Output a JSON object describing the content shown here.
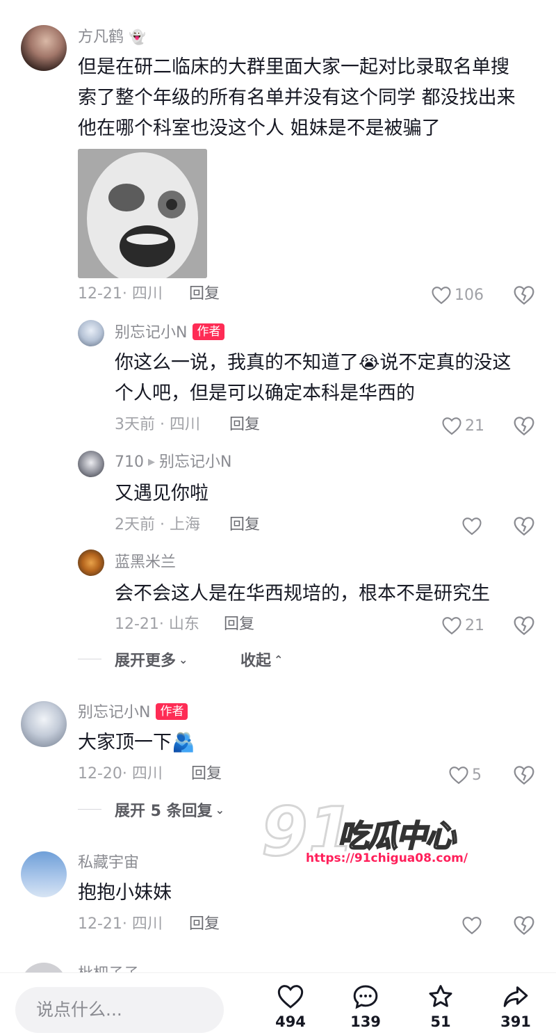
{
  "comments": [
    {
      "user": "方凡鹤",
      "text_lines": [
        "但是在研二临床的大群里面大家一起对比录取名单搜",
        "索了整个年级的所有名单并没有这个同学 都没找出来",
        "他在哪个科室也没这个人 姐妹是不是被骗了"
      ],
      "meta": "12-21· 四川",
      "reply": "回复",
      "likes": "106"
    },
    {
      "user": "别忘记小N",
      "badge": "作者",
      "text_lines": [
        "你这么一说，我真的不知道了",
        "说不定真的没这",
        "个人吧，但是可以确定本科是华西的"
      ],
      "meta": "3天前 · 四川",
      "reply": "回复",
      "likes": "21"
    },
    {
      "user": "710",
      "reply_to": "别忘记小N",
      "text": "又遇见你啦",
      "meta": "2天前 · 上海",
      "reply": "回复",
      "likes": ""
    },
    {
      "user": "蓝黑米兰",
      "text": "会不会这人是在华西规培的，根本不是研究生",
      "meta": "12-21· 山东",
      "reply": "回复",
      "likes": "21"
    },
    {
      "user": "别忘记小N",
      "badge": "作者",
      "text": "大家顶一下",
      "meta": "12-20· 四川",
      "reply": "回复",
      "likes": "5"
    },
    {
      "user": "私藏宇宙",
      "text": "抱抱小妹妹",
      "meta": "12-21· 四川",
      "reply": "回复",
      "likes": ""
    }
  ],
  "expand_more": "展开更多",
  "collapse": "收起",
  "expand_replies": "展开 5 条回复",
  "watermark": {
    "number": "91",
    "title": "吃瓜中心",
    "url": "https://91chigua08.com/"
  },
  "partial_user": "枇杷子子",
  "bottom_bar": {
    "input_placeholder": "说点什么...",
    "likes": "494",
    "comments": "139",
    "favorites": "51",
    "shares": "391"
  },
  "colors": {
    "accent": "#fe2c55",
    "text": "#161823",
    "secondary": "#8a8b91"
  }
}
